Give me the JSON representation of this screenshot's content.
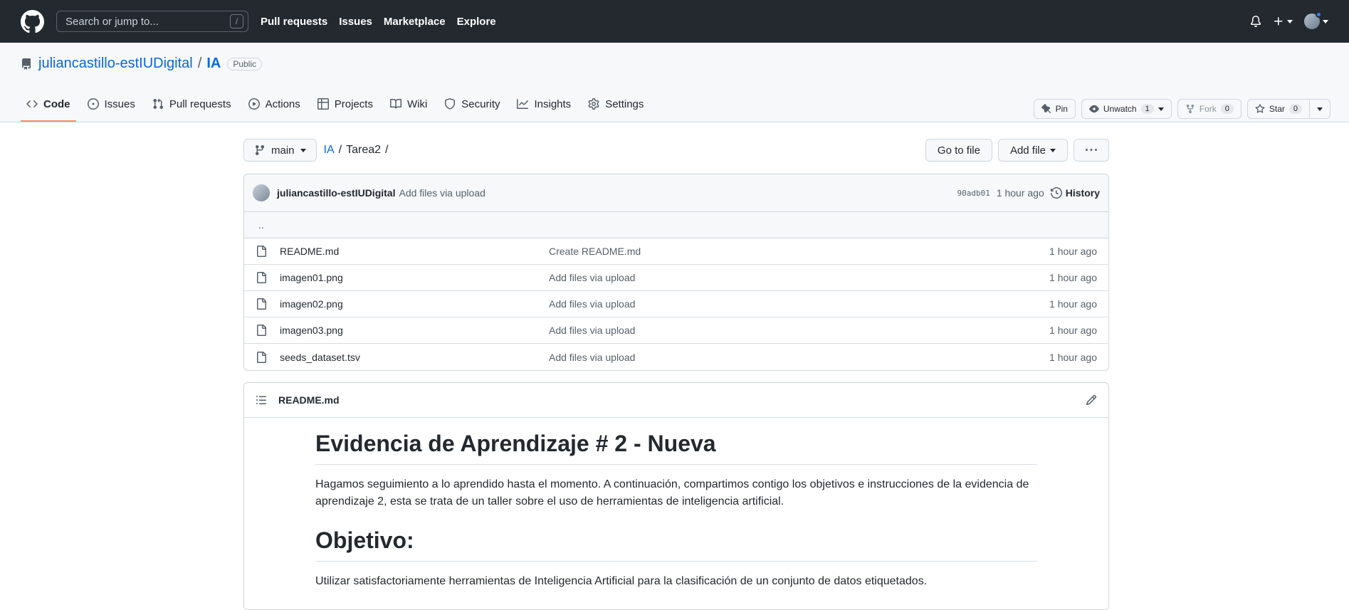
{
  "header": {
    "search_placeholder": "Search or jump to...",
    "search_shortcut": "/",
    "nav": [
      "Pull requests",
      "Issues",
      "Marketplace",
      "Explore"
    ]
  },
  "repo": {
    "owner": "juliancastillo-estIUDigital",
    "separator": "/",
    "name": "IA",
    "visibility": "Public",
    "actions": {
      "pin": "Pin",
      "unwatch": "Unwatch",
      "watch_count": "1",
      "fork": "Fork",
      "fork_count": "0",
      "star": "Star",
      "star_count": "0"
    },
    "tabs": [
      {
        "label": "Code",
        "icon": "code-icon",
        "active": true
      },
      {
        "label": "Issues",
        "icon": "issue-icon"
      },
      {
        "label": "Pull requests",
        "icon": "pull-request-icon"
      },
      {
        "label": "Actions",
        "icon": "play-icon"
      },
      {
        "label": "Projects",
        "icon": "table-icon"
      },
      {
        "label": "Wiki",
        "icon": "book-icon"
      },
      {
        "label": "Security",
        "icon": "shield-icon"
      },
      {
        "label": "Insights",
        "icon": "graph-icon"
      },
      {
        "label": "Settings",
        "icon": "gear-icon"
      }
    ]
  },
  "path": {
    "branch": "main",
    "root": "IA",
    "folder": "Tarea2",
    "sep": "/",
    "go_to_file": "Go to file",
    "add_file": "Add file",
    "more": "···"
  },
  "commit": {
    "author": "juliancastillo-estIUDigital",
    "message": "Add files via upload",
    "sha": "90adb01",
    "age": "1 hour ago",
    "history": "History"
  },
  "up_dir": "..",
  "files": [
    {
      "name": "README.md",
      "message": "Create README.md",
      "age": "1 hour ago"
    },
    {
      "name": "imagen01.png",
      "message": "Add files via upload",
      "age": "1 hour ago"
    },
    {
      "name": "imagen02.png",
      "message": "Add files via upload",
      "age": "1 hour ago"
    },
    {
      "name": "imagen03.png",
      "message": "Add files via upload",
      "age": "1 hour ago"
    },
    {
      "name": "seeds_dataset.tsv",
      "message": "Add files via upload",
      "age": "1 hour ago"
    }
  ],
  "readme": {
    "filename": "README.md",
    "h1": "Evidencia de Aprendizaje # 2 - Nueva",
    "p1": "Hagamos seguimiento a lo aprendido hasta el momento. A continuación, compartimos contigo los objetivos e instrucciones de la evidencia de aprendizaje 2, esta se trata de un taller sobre el uso de herramientas de inteligencia artificial.",
    "h2": "Objetivo:",
    "p2": "Utilizar satisfactoriamente herramientas de Inteligencia Artificial para la clasificación de un conjunto de datos etiquetados."
  }
}
